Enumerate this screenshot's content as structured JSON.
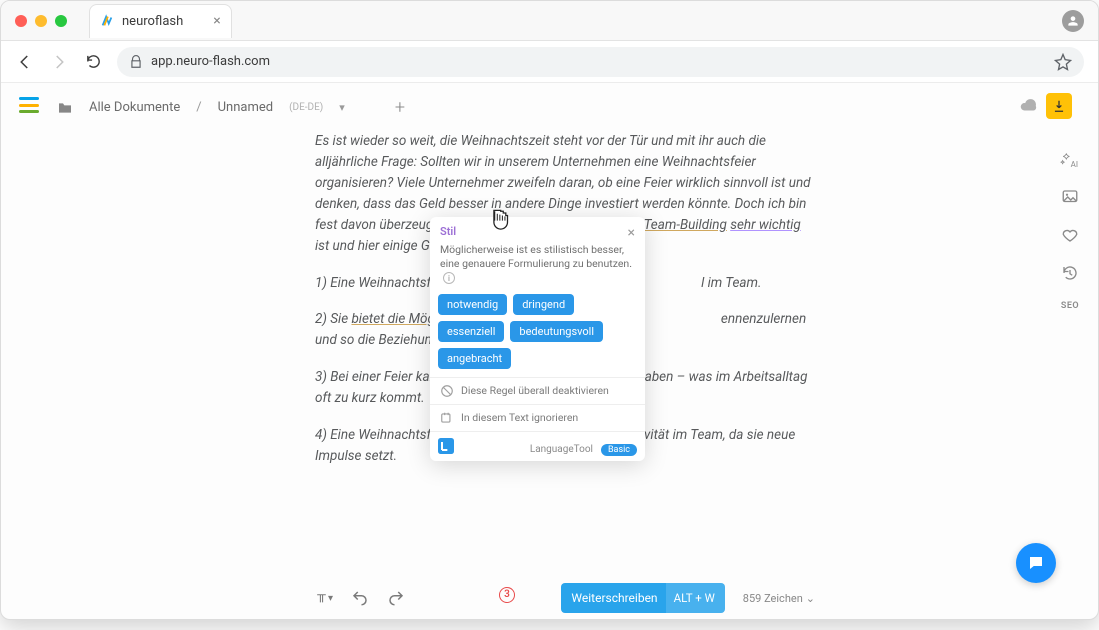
{
  "browser": {
    "tab_title": "neuroflash",
    "url": "app.neuro-flash.com"
  },
  "toolbar": {
    "all_documents": "Alle Dokumente",
    "separator": "/",
    "doc_name": "Unnamed",
    "doc_lang": "(DE-DE)"
  },
  "document": {
    "intro": "Es ist wieder so weit, die Weihnachtszeit steht vor der Tür und mit ihr auch die alljährliche Frage: Sollten wir in unserem Unternehmen eine Weihnachtsfeier organisieren? Viele Unternehmer zweifeln daran, ob eine Feier wirklich sinnvoll ist und denken, dass das Geld besser in andere Dinge investiert werden könnte. Doch ich bin fest davon überzeugt, dass eine Weihnachtsfeier für das ",
    "underline1": "Team-Building",
    "space1": " ",
    "highlight": "sehr wichtig",
    "intro_end": " ist und hier einige Gründe, warum:",
    "p1_a": "1) Eine Weihnachtsfei",
    "p1_b": "l im Team.",
    "p2_a": "2) Sie ",
    "p2_und": "bietet die Möglic",
    "p2_b": "ennenzulernen und so die Beziehungen im Team",
    "p3": "3) Bei einer Feier kann                                                       ß haben – was im Arbeitsalltag oft zu kurz kommt.",
    "p4": "4) Eine Weihnachtsfeier fördert die Motivation und Kreativität im Team, da sie neue Impulse setzt."
  },
  "popover": {
    "title": "Stil",
    "body": "Möglicherweise ist es stilistisch besser, eine genauere Formulierung zu benutzen.",
    "suggestions": [
      "notwendig",
      "dringend",
      "essenziell",
      "bedeutungsvoll",
      "angebracht"
    ],
    "deactivate": "Diese Regel überall deaktivieren",
    "ignore": "In diesem Text ignorieren",
    "brand": "LanguageTool",
    "badge": "Basic"
  },
  "bottom": {
    "weiter_label": "Weiterschreiben",
    "weiter_shortcut": "ALT + W",
    "char_count": "859 Zeichen"
  },
  "error_badge": "3",
  "right_rail": {
    "seo": "SEO"
  }
}
